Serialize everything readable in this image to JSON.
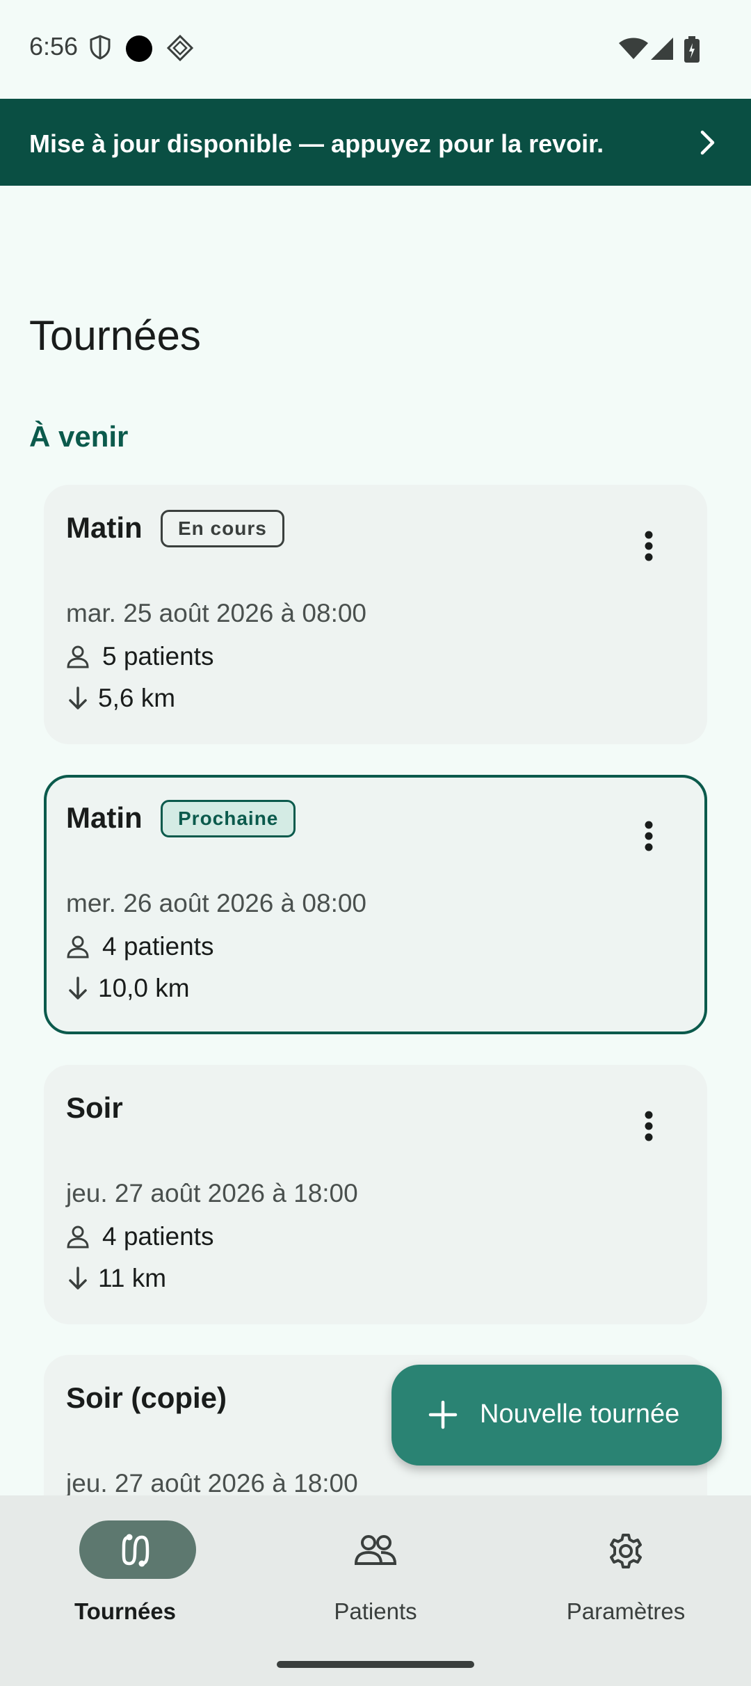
{
  "status_bar": {
    "time": "6:56"
  },
  "banner": {
    "text": "Mise à jour disponible — appuyez pour la revoir."
  },
  "page": {
    "title": "Tournées",
    "section_title": "À venir"
  },
  "cards": [
    {
      "title": "Matin",
      "badge": "En cours",
      "date": "mar. 25 août 2026 à 08:00",
      "patients": "5 patients",
      "distance": "5,6 km"
    },
    {
      "title": "Matin",
      "badge": "Prochaine",
      "date": "mer. 26 août 2026 à 08:00",
      "patients": "4 patients",
      "distance": "10,0 km"
    },
    {
      "title": "Soir",
      "badge": "",
      "date": "jeu. 27 août 2026 à 18:00",
      "patients": "4 patients",
      "distance": "11 km"
    },
    {
      "title": "Soir (copie)",
      "badge": "",
      "date": "jeu. 27 août 2026 à 18:00"
    }
  ],
  "fab": {
    "label": "Nouvelle tournée"
  },
  "bottom_nav": {
    "items": [
      {
        "label": "Tournées",
        "icon": "route-icon",
        "active": true
      },
      {
        "label": "Patients",
        "icon": "people-icon",
        "active": false
      },
      {
        "label": "Paramètres",
        "icon": "gear-icon",
        "active": false
      }
    ]
  },
  "colors": {
    "primary": "#0b5a4c",
    "banner": "#0a4f43",
    "fab": "#2a8373",
    "background": "#f3fbf8"
  }
}
